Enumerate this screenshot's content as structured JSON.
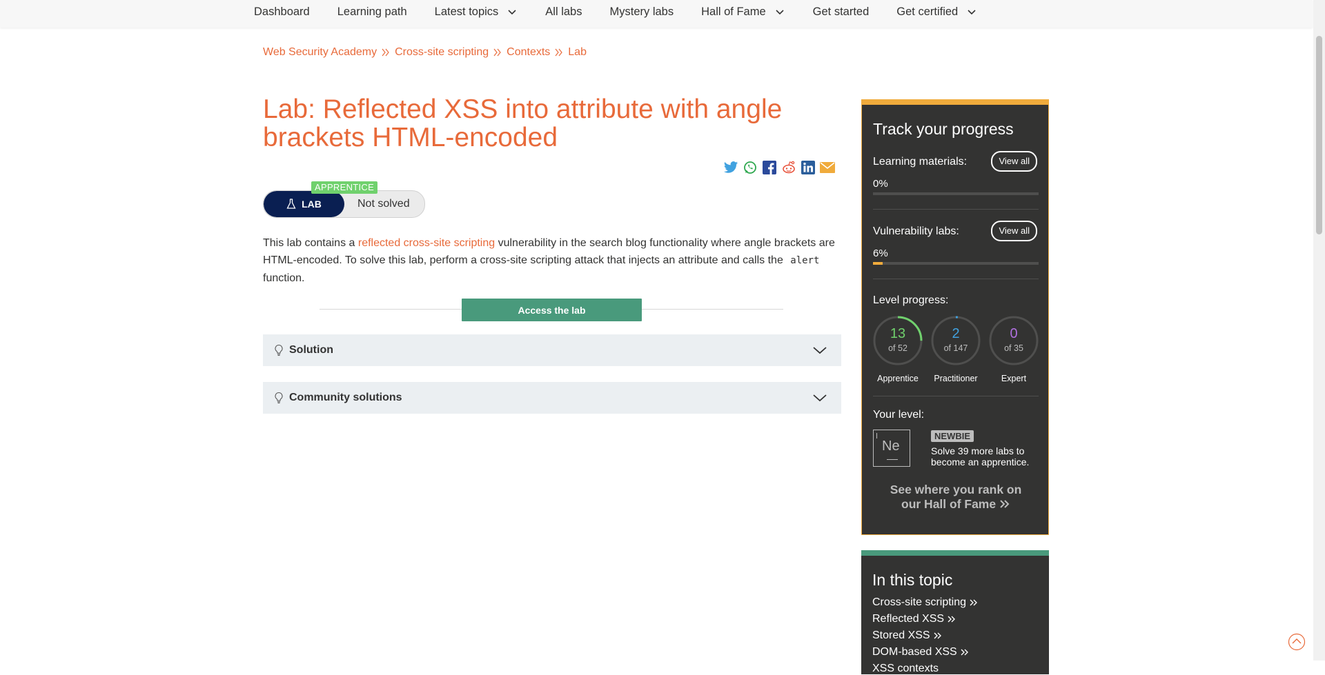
{
  "nav": {
    "items": [
      {
        "label": "Dashboard",
        "dropdown": false
      },
      {
        "label": "Learning path",
        "dropdown": false
      },
      {
        "label": "Latest topics",
        "dropdown": true
      },
      {
        "label": "All labs",
        "dropdown": false
      },
      {
        "label": "Mystery labs",
        "dropdown": false
      },
      {
        "label": "Hall of Fame",
        "dropdown": true
      },
      {
        "label": "Get started",
        "dropdown": false
      },
      {
        "label": "Get certified",
        "dropdown": true
      }
    ]
  },
  "breadcrumb": [
    "Web Security Academy",
    "Cross-site scripting",
    "Contexts",
    "Lab"
  ],
  "title": "Lab: Reflected XSS into attribute with angle brackets HTML-encoded",
  "share_icons": [
    "twitter-icon",
    "whatsapp-icon",
    "facebook-icon",
    "reddit-icon",
    "linkedin-icon",
    "email-icon"
  ],
  "lab_badge": {
    "level": "APPRENTICE",
    "lab_label": "LAB",
    "status": "Not solved"
  },
  "description": {
    "before_link": "This lab contains a ",
    "link_text": "reflected cross-site scripting",
    "after_link": " vulnerability in the search blog functionality where angle brackets are HTML-encoded. To solve this lab, perform a cross-site scripting attack that injects an attribute and calls the ",
    "code": "alert",
    "after_code": " function."
  },
  "access_button": "Access the lab",
  "accordions": [
    "Solution",
    "Community solutions"
  ],
  "progress": {
    "title": "Track your progress",
    "learning_label": "Learning materials:",
    "learning_pct": "0%",
    "learning_fraction": 0.0,
    "vuln_label": "Vulnerability labs:",
    "vuln_pct": "6%",
    "vuln_fraction": 0.06,
    "view_all": "View all",
    "level_progress_label": "Level progress:",
    "levels": [
      {
        "name": "Apprentice",
        "count": "13",
        "of": "of 52",
        "fraction": 0.25,
        "color": "#70d16d"
      },
      {
        "name": "Practitioner",
        "count": "2",
        "of": "of 147",
        "fraction": 0.0136,
        "color": "#41a2e0"
      },
      {
        "name": "Expert",
        "count": "0",
        "of": "of 35",
        "fraction": 0.0,
        "color": "#b070e0"
      }
    ],
    "your_level_label": "Your level:",
    "level_symbol": "Ne",
    "level_badge": "NEWBIE",
    "level_message": "Solve 39 more labs to become an apprentice.",
    "rank_link": "See where you rank on our Hall of Fame"
  },
  "topic": {
    "title": "In this topic",
    "links": [
      "Cross-site scripting",
      "Reflected XSS",
      "Stored XSS",
      "DOM-based XSS",
      "XSS contexts"
    ]
  },
  "colors": {
    "accent": "#e86a3a",
    "nav_dark": "#0a1f52",
    "apprentice": "#70d16d",
    "access_green": "#499a7c",
    "progress_orange": "#f0ab3c",
    "sidebar_bg": "#333332"
  }
}
